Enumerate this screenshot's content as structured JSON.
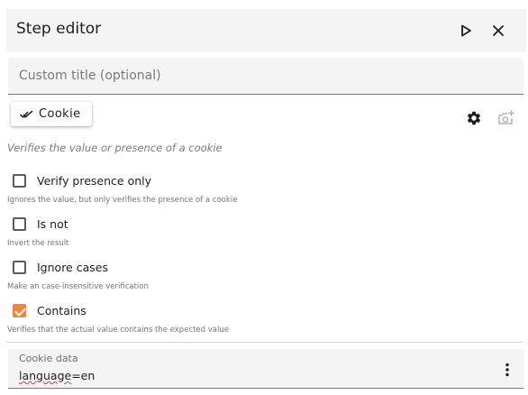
{
  "header": {
    "title": "Step editor"
  },
  "title_field": {
    "placeholder": "Custom title (optional)",
    "value": ""
  },
  "step_type": {
    "label": "Cookie"
  },
  "description": "Verifies the value or presence of a cookie",
  "options": [
    {
      "label": "Verify presence only",
      "hint": "Ignores the value, but only verifies the presence of a cookie",
      "checked": false
    },
    {
      "label": "Is not",
      "hint": "Invert the result",
      "checked": false
    },
    {
      "label": "Ignore cases",
      "hint": "Make an case-insensitive verification",
      "checked": false
    },
    {
      "label": "Contains",
      "hint": "Verifies that the actual value contains the expected value",
      "checked": true
    }
  ],
  "cookie_data": {
    "label": "Cookie data",
    "value_key": "language",
    "value_rest": "=en"
  },
  "colors": {
    "accent": "#f0853f",
    "header_bg": "#f4f4f4",
    "hint_text": "#777777"
  },
  "icons": {
    "play": "play-icon",
    "close": "close-icon",
    "step_type": "double-check-icon",
    "settings": "gear-icon",
    "screenshot": "add-camera-icon",
    "more": "more-vertical-icon"
  }
}
